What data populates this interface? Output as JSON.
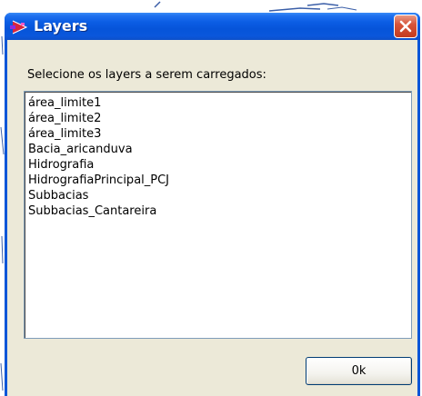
{
  "window": {
    "title": "Layers"
  },
  "dialog": {
    "prompt": "Selecione os layers a serem carregados:",
    "layers": [
      "área_limite1",
      "área_limite2",
      "área_limite3",
      "Bacia_aricanduva",
      "Hidrografia",
      "HidrografiaPrincipal_PCJ",
      "Subbacias",
      "Subbacias_Cantareira"
    ],
    "ok_label": "0k"
  },
  "icons": {
    "app": "layers-app-icon",
    "close": "close-icon"
  },
  "colors": {
    "titlebar": "#0654d9",
    "frame": "#0a56d8",
    "close_button": "#d8553b",
    "client_bg": "#ece9d8",
    "listbox_border": "#7f9db9",
    "button_border": "#003c74"
  }
}
